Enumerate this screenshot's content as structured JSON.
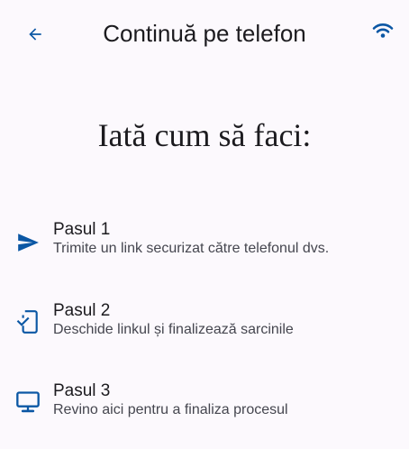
{
  "colors": {
    "accent": "#0b57a4",
    "background": "#fcf9fd",
    "text_primary": "#1c1b1f",
    "text_secondary": "#45464f"
  },
  "app_bar": {
    "back_icon": "arrow-back-icon",
    "title": "Continuă pe telefon",
    "status_icon": "wifi-icon"
  },
  "heading": "Iată cum să faci:",
  "steps": [
    {
      "icon": "send-icon",
      "title": "Pasul 1",
      "description": "Trimite un link securizat către telefonul dvs."
    },
    {
      "icon": "phone-check-icon",
      "title": "Pasul 2",
      "description": "Deschide linkul și finalizează sarcinile"
    },
    {
      "icon": "desktop-icon",
      "title": "Pasul 3",
      "description": "Revino aici pentru a finaliza procesul"
    }
  ]
}
